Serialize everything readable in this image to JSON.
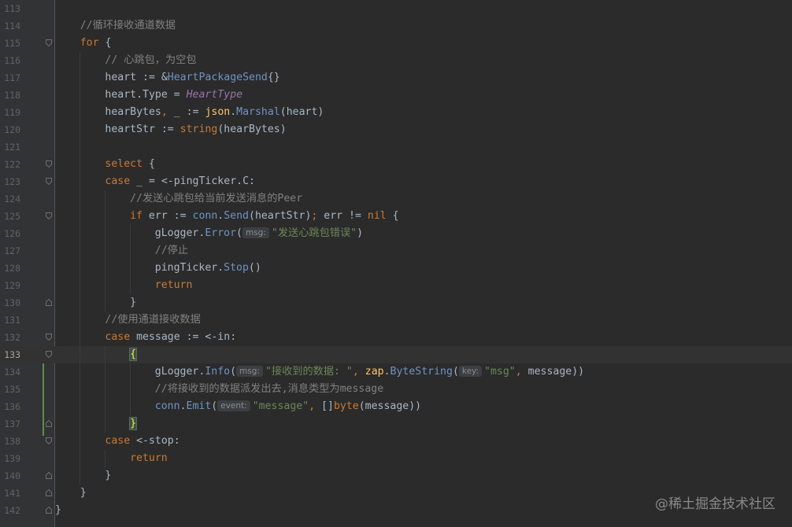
{
  "current_line": 133,
  "watermark": "@稀土掘金技术社区",
  "lines": [
    {
      "n": "113",
      "indent": 0,
      "fold": null,
      "tokens": []
    },
    {
      "n": "114",
      "indent": 1,
      "fold": null,
      "tokens": [
        {
          "c": "cm",
          "t": "//循环接收通道数据"
        }
      ]
    },
    {
      "n": "115",
      "indent": 1,
      "fold": "open",
      "tokens": [
        {
          "c": "kw",
          "t": "for"
        },
        {
          "c": "",
          "t": " {"
        }
      ]
    },
    {
      "n": "116",
      "indent": 2,
      "fold": null,
      "tokens": [
        {
          "c": "cm",
          "t": "// 心跳包，为空包"
        }
      ]
    },
    {
      "n": "117",
      "indent": 2,
      "fold": null,
      "tokens": [
        {
          "c": "",
          "t": "heart := &"
        },
        {
          "c": "ty",
          "t": "HeartPackageSend"
        },
        {
          "c": "",
          "t": "{}"
        }
      ]
    },
    {
      "n": "118",
      "indent": 2,
      "fold": null,
      "tokens": [
        {
          "c": "",
          "t": "heart.Type = "
        },
        {
          "c": "cn",
          "t": "HeartType"
        }
      ]
    },
    {
      "n": "119",
      "indent": 2,
      "fold": null,
      "tokens": [
        {
          "c": "",
          "t": "hearBytes"
        },
        {
          "c": "kw",
          "t": ","
        },
        {
          "c": "",
          "t": " _ := "
        },
        {
          "c": "fn",
          "t": "json"
        },
        {
          "c": "",
          "t": "."
        },
        {
          "c": "mt",
          "t": "Marshal"
        },
        {
          "c": "",
          "t": "(heart)"
        }
      ]
    },
    {
      "n": "120",
      "indent": 2,
      "fold": null,
      "tokens": [
        {
          "c": "",
          "t": "heartStr := "
        },
        {
          "c": "kw",
          "t": "string"
        },
        {
          "c": "",
          "t": "(hearBytes)"
        }
      ]
    },
    {
      "n": "121",
      "indent": 2,
      "fold": null,
      "tokens": []
    },
    {
      "n": "122",
      "indent": 2,
      "fold": "open",
      "tokens": [
        {
          "c": "kw",
          "t": "select"
        },
        {
          "c": "",
          "t": " {"
        }
      ]
    },
    {
      "n": "123",
      "indent": 2,
      "fold": "open",
      "tokens": [
        {
          "c": "kw",
          "t": "case"
        },
        {
          "c": "",
          "t": " _ = <-pingTicker.C:"
        }
      ]
    },
    {
      "n": "124",
      "indent": 3,
      "fold": null,
      "tokens": [
        {
          "c": "cm",
          "t": "//发送心跳包给当前发送消息的Peer"
        }
      ]
    },
    {
      "n": "125",
      "indent": 3,
      "fold": "open",
      "tokens": [
        {
          "c": "kw",
          "t": "if"
        },
        {
          "c": "",
          "t": " err := "
        },
        {
          "c": "pk",
          "t": "conn"
        },
        {
          "c": "",
          "t": "."
        },
        {
          "c": "mt",
          "t": "Send"
        },
        {
          "c": "",
          "t": "(heartStr)"
        },
        {
          "c": "kw",
          "t": ";"
        },
        {
          "c": "",
          "t": " err != "
        },
        {
          "c": "kw",
          "t": "nil"
        },
        {
          "c": "",
          "t": " {"
        }
      ]
    },
    {
      "n": "126",
      "indent": 4,
      "fold": null,
      "tokens": [
        {
          "c": "",
          "t": "gLogger."
        },
        {
          "c": "mt",
          "t": "Error"
        },
        {
          "c": "",
          "t": "("
        },
        {
          "c": "hint",
          "t": "msg:"
        },
        {
          "c": "st",
          "t": "\"发送心跳包错误\""
        },
        {
          "c": "",
          "t": ")"
        }
      ]
    },
    {
      "n": "127",
      "indent": 4,
      "fold": null,
      "tokens": [
        {
          "c": "cm",
          "t": "//停止"
        }
      ]
    },
    {
      "n": "128",
      "indent": 4,
      "fold": null,
      "tokens": [
        {
          "c": "",
          "t": "pingTicker."
        },
        {
          "c": "mt",
          "t": "Stop"
        },
        {
          "c": "",
          "t": "()"
        }
      ]
    },
    {
      "n": "129",
      "indent": 4,
      "fold": null,
      "tokens": [
        {
          "c": "kw",
          "t": "return"
        }
      ]
    },
    {
      "n": "130",
      "indent": 3,
      "fold": "close",
      "tokens": [
        {
          "c": "",
          "t": "}"
        }
      ]
    },
    {
      "n": "131",
      "indent": 2,
      "fold": null,
      "tokens": [
        {
          "c": "cm",
          "t": "//使用通道接收数据"
        }
      ]
    },
    {
      "n": "132",
      "indent": 2,
      "fold": "open",
      "tokens": [
        {
          "c": "kw",
          "t": "case"
        },
        {
          "c": "",
          "t": " message := <-in:"
        }
      ]
    },
    {
      "n": "133",
      "indent": 3,
      "fold": "open",
      "tokens": [
        {
          "c": "bm",
          "t": "{"
        }
      ]
    },
    {
      "n": "134",
      "indent": 4,
      "fold": null,
      "tokens": [
        {
          "c": "",
          "t": "gLogger."
        },
        {
          "c": "mt",
          "t": "Info"
        },
        {
          "c": "",
          "t": "("
        },
        {
          "c": "hint",
          "t": "msg:"
        },
        {
          "c": "st",
          "t": "\"接收到的数据: \""
        },
        {
          "c": "kw",
          "t": ","
        },
        {
          "c": "",
          "t": " "
        },
        {
          "c": "fn",
          "t": "zap"
        },
        {
          "c": "",
          "t": "."
        },
        {
          "c": "mt",
          "t": "ByteString"
        },
        {
          "c": "",
          "t": "("
        },
        {
          "c": "hint",
          "t": "key:"
        },
        {
          "c": "st",
          "t": "\"msg\""
        },
        {
          "c": "kw",
          "t": ","
        },
        {
          "c": "",
          "t": " message))"
        }
      ]
    },
    {
      "n": "135",
      "indent": 4,
      "fold": null,
      "tokens": [
        {
          "c": "cm",
          "t": "//将接收到的数据派发出去,消息类型为message"
        }
      ]
    },
    {
      "n": "136",
      "indent": 4,
      "fold": null,
      "tokens": [
        {
          "c": "pk",
          "t": "conn"
        },
        {
          "c": "",
          "t": "."
        },
        {
          "c": "mt",
          "t": "Emit"
        },
        {
          "c": "",
          "t": "("
        },
        {
          "c": "hint",
          "t": "event:"
        },
        {
          "c": "st",
          "t": "\"message\""
        },
        {
          "c": "kw",
          "t": ","
        },
        {
          "c": "",
          "t": " []"
        },
        {
          "c": "kw",
          "t": "byte"
        },
        {
          "c": "",
          "t": "(message))"
        }
      ]
    },
    {
      "n": "137",
      "indent": 3,
      "fold": "close",
      "tokens": [
        {
          "c": "bm",
          "t": "}"
        }
      ]
    },
    {
      "n": "138",
      "indent": 2,
      "fold": "open",
      "tokens": [
        {
          "c": "kw",
          "t": "case"
        },
        {
          "c": "",
          "t": " <-stop:"
        }
      ]
    },
    {
      "n": "139",
      "indent": 3,
      "fold": null,
      "tokens": [
        {
          "c": "kw",
          "t": "return"
        }
      ]
    },
    {
      "n": "140",
      "indent": 2,
      "fold": "close",
      "tokens": [
        {
          "c": "",
          "t": "}"
        }
      ]
    },
    {
      "n": "141",
      "indent": 1,
      "fold": "close",
      "tokens": [
        {
          "c": "",
          "t": "}"
        }
      ]
    },
    {
      "n": "142",
      "indent": 0,
      "fold": "close",
      "tokens": [
        {
          "c": "",
          "t": "}"
        }
      ]
    }
  ]
}
